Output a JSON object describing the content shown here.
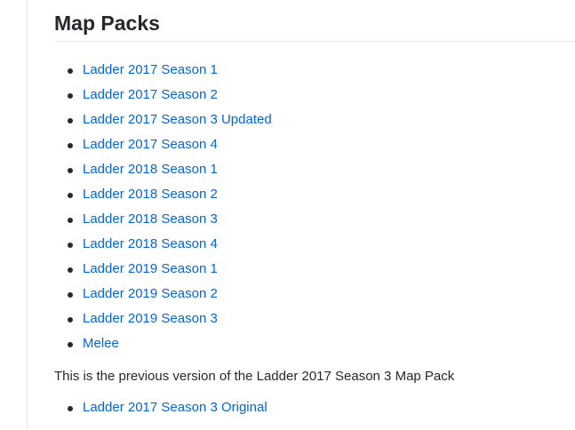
{
  "section": {
    "title": "Map Packs"
  },
  "map_packs": [
    "Ladder 2017 Season 1",
    "Ladder 2017 Season 2",
    "Ladder 2017 Season 3 Updated",
    "Ladder 2017 Season 4",
    "Ladder 2018 Season 1",
    "Ladder 2018 Season 2",
    "Ladder 2018 Season 3",
    "Ladder 2018 Season 4",
    "Ladder 2019 Season 1",
    "Ladder 2019 Season 2",
    "Ladder 2019 Season 3",
    "Melee"
  ],
  "note": "This is the previous version of the Ladder 2017 Season 3 Map Pack",
  "previous_versions": [
    "Ladder 2017 Season 3 Original"
  ],
  "colors": {
    "link": "#0366d6",
    "text": "#24292e",
    "divider": "#eaecef"
  }
}
